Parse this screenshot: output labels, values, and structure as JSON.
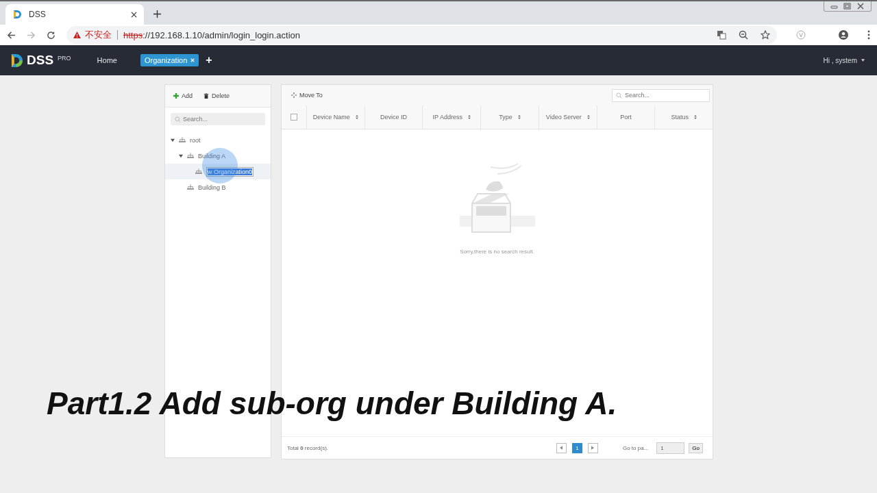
{
  "browser": {
    "tab_title": "DSS",
    "security_label": "不安全",
    "url_scheme": "https",
    "url_rest": "://192.168.1.10/admin/login_login.action"
  },
  "header": {
    "logo": "DSS",
    "logo_badge": "PRO",
    "nav": [
      {
        "label": "Home",
        "selected": false
      },
      {
        "label": "Organization",
        "selected": true
      }
    ],
    "add_tab": "+",
    "user": "Hi , system"
  },
  "tree_panel": {
    "actions": [
      "Add",
      "Delete"
    ],
    "search": {
      "placeholder": "Search..."
    },
    "tree": [
      {
        "label": "root",
        "expanded": true,
        "selected": false,
        "children": [
          {
            "label": "Building A",
            "expanded": true,
            "selected": false,
            "children": [
              {
                "label": "w Organization0",
                "selected": true,
                "editing": true
              }
            ]
          },
          {
            "label": "Building B",
            "selected": false
          }
        ]
      }
    ]
  },
  "device_panel": {
    "move_to": "Move To",
    "search": {
      "placeholder": "Search..."
    },
    "select_all": {
      "checked": false
    },
    "columns": [
      {
        "label": "Device Name",
        "sortable": true
      },
      {
        "label": "Device ID",
        "sortable": false
      },
      {
        "label": "IP Address",
        "sortable": true
      },
      {
        "label": "Type",
        "sortable": true
      },
      {
        "label": "Video Server",
        "sortable": true
      },
      {
        "label": "Port",
        "sortable": false
      },
      {
        "label": "Status",
        "sortable": true
      }
    ],
    "empty_message": "Sorry,there is no search result.",
    "footer": {
      "total": "Total **0** record(s).",
      "pages": [
        {
          "label": "1",
          "selected": true
        }
      ],
      "goto_label": "Go to pa...",
      "goto_value": "1",
      "go": "Go"
    }
  },
  "caption": "Part1.2 Add sub-org under Building A."
}
